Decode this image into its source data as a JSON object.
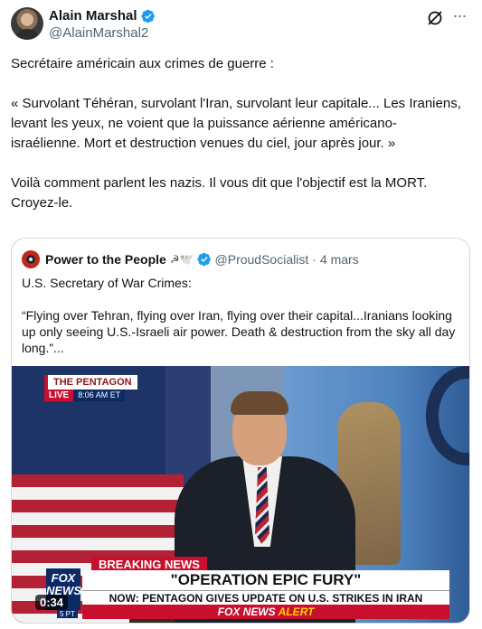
{
  "author": {
    "display_name": "Alain Marshal",
    "handle": "@AlainMarshal2",
    "verified": true
  },
  "icons": {
    "verified": "verified-badge-icon",
    "grok": "grok-icon",
    "more": "more-icon"
  },
  "more_label": "···",
  "tweet": {
    "paragraphs": [
      "Secrétaire américain aux crimes de guerre :",
      "« Survolant Téhéran, survolant l'Iran, survolant leur capitale... Les Iraniens, levant les yeux, ne voient que la puissance aérienne américano-israélienne. Mort et destruction venues du ciel, jour après jour. »",
      "Voilà comment parlent les nazis. Il vous dit que l'objectif est la MORT. Croyez-le."
    ]
  },
  "quote": {
    "display_name": "Power to the People",
    "name_emoji": "☭🕊️",
    "handle": "@ProudSocialist",
    "separator": "·",
    "date": "4 mars",
    "text": [
      "U.S. Secretary of War Crimes:",
      "“Flying over Tehran, flying over Iran, flying over their capital...Iranians looking up only seeing U.S.-Israeli air power. Death & destruction from the sky all day long.”..."
    ],
    "video": {
      "pentagon_label": "THE PENTAGON",
      "live_label": "LIVE",
      "time_label": "8:06 AM ET",
      "breaking_label": "BREAKING NEWS",
      "headline": "\"OPERATION EPIC FURY\"",
      "subline": "NOW: PENTAGON GIVES UPDATE ON U.S. STRIKES IN IRAN",
      "alert_prefix": "FOX NEWS",
      "alert_word": "ALERT",
      "logo_text": "FOX NEWS",
      "logo_sub": "5 PT",
      "duration": "0:34"
    }
  },
  "colors": {
    "verified_blue": "#1d9bf0",
    "text_secondary": "#536471",
    "border": "#cfd9de",
    "fox_red": "#c8102e",
    "fox_navy": "#0b2a66"
  }
}
